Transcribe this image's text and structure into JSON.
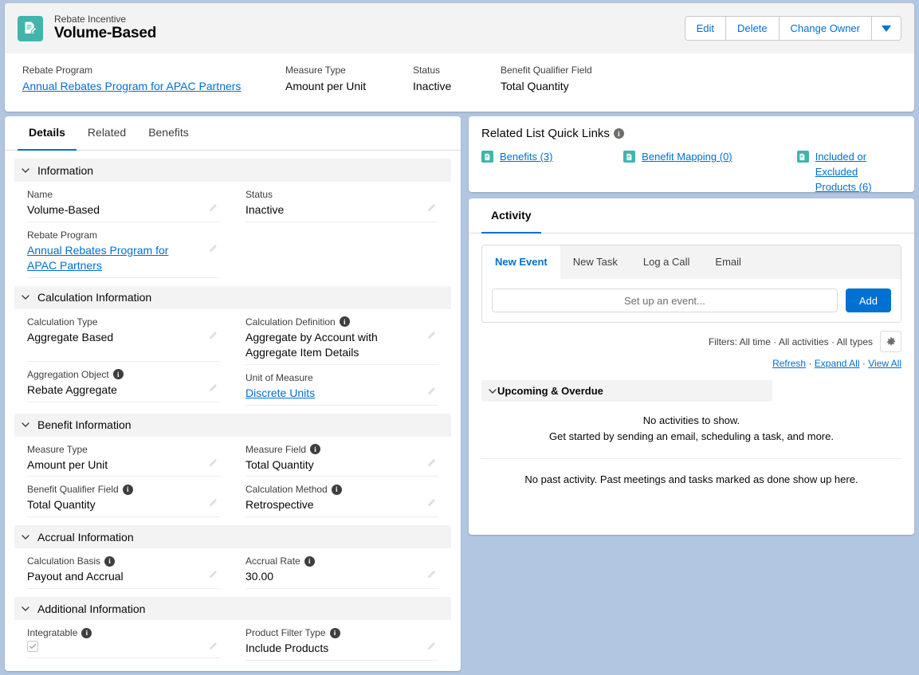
{
  "header": {
    "eyebrow": "Rebate Incentive",
    "title": "Volume-Based",
    "record_icon": "document-edit-icon",
    "actions": [
      {
        "label": "Edit",
        "name": "edit-button"
      },
      {
        "label": "Delete",
        "name": "delete-button"
      },
      {
        "label": "Change Owner",
        "name": "change-owner-button"
      }
    ],
    "more_actions_icon": "chevron-down-icon",
    "fields": [
      {
        "label": "Rebate Program",
        "value": "Annual Rebates Program for APAC Partners",
        "is_link": true
      },
      {
        "label": "Measure Type",
        "value": "Amount per Unit",
        "is_link": false
      },
      {
        "label": "Status",
        "value": "Inactive",
        "is_link": false
      },
      {
        "label": "Benefit Qualifier Field",
        "value": "Total Quantity",
        "is_link": false
      }
    ]
  },
  "tabs": [
    {
      "label": "Details",
      "active": true
    },
    {
      "label": "Related",
      "active": false
    },
    {
      "label": "Benefits",
      "active": false
    }
  ],
  "sections": {
    "information": {
      "title": "Information",
      "name_label": "Name",
      "name_value": "Volume-Based",
      "status_label": "Status",
      "status_value": "Inactive",
      "rebate_program_label": "Rebate Program",
      "rebate_program_value": "Annual Rebates Program for APAC Partners"
    },
    "calculation": {
      "title": "Calculation Information",
      "calc_type_label": "Calculation Type",
      "calc_type_value": "Aggregate Based",
      "calc_def_label": "Calculation Definition",
      "calc_def_value": "Aggregate by Account with Aggregate Item Details",
      "agg_object_label": "Aggregation Object",
      "agg_object_value": "Rebate Aggregate",
      "uom_label": "Unit of Measure",
      "uom_value": "Discrete Units"
    },
    "benefit": {
      "title": "Benefit Information",
      "measure_type_label": "Measure Type",
      "measure_type_value": "Amount per Unit",
      "measure_field_label": "Measure Field",
      "measure_field_value": "Total Quantity",
      "qualifier_label": "Benefit Qualifier Field",
      "qualifier_value": "Total Quantity",
      "calc_method_label": "Calculation Method",
      "calc_method_value": "Retrospective"
    },
    "accrual": {
      "title": "Accrual Information",
      "basis_label": "Calculation Basis",
      "basis_value": "Payout and Accrual",
      "rate_label": "Accrual Rate",
      "rate_value": "30.00"
    },
    "additional": {
      "title": "Additional Information",
      "integratable_label": "Integratable",
      "integratable_checked": true,
      "filter_type_label": "Product Filter Type",
      "filter_type_value": "Include Products"
    }
  },
  "quick_links": {
    "title": "Related List Quick Links",
    "info_icon": "info-icon",
    "items": [
      {
        "label": "Benefits (3)",
        "icon": "document-icon"
      },
      {
        "label": "Benefit Mapping (0)",
        "icon": "document-icon"
      },
      {
        "label": "Included or Excluded Products (6)",
        "icon": "document-icon"
      }
    ]
  },
  "activity": {
    "tab_label": "Activity",
    "composer_tabs": [
      {
        "label": "New Event",
        "active": true
      },
      {
        "label": "New Task",
        "active": false
      },
      {
        "label": "Log a Call",
        "active": false
      },
      {
        "label": "Email",
        "active": false
      }
    ],
    "input_placeholder": "Set up an event...",
    "input_value": "",
    "add_label": "Add",
    "filters_text": "Filters: All time · All activities · All types",
    "settings_icon": "gear-icon",
    "links": {
      "refresh": "Refresh",
      "expand_all": "Expand All",
      "view_all": "View All",
      "separator": "·"
    },
    "upcoming_title": "Upcoming & Overdue",
    "empty_line1": "No activities to show.",
    "empty_line2": "Get started by sending an email, scheduling a task, and more.",
    "past_msg": "No past activity. Past meetings and tasks marked as done show up here."
  },
  "colors": {
    "brand_blue": "#0070d2",
    "record_icon_teal": "#41b4ac",
    "page_background": "#b2c6e2",
    "section_header": "#f3f3f3"
  }
}
